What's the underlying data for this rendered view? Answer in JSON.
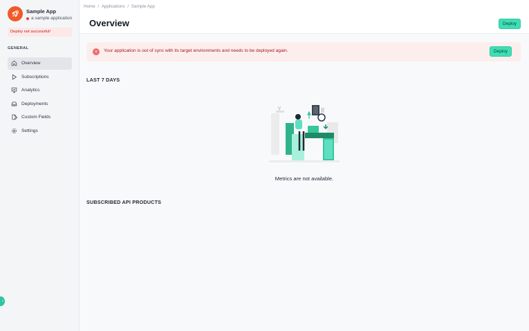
{
  "sidebar": {
    "app_name": "Sample App",
    "app_description": "a sample application",
    "status_color": "#e0413a",
    "avatar_color": "#f05a28",
    "deploy_status": "Deploy not successful!",
    "section_label": "GENERAL",
    "items": [
      {
        "label": "Overview",
        "icon": "home-icon",
        "active": true
      },
      {
        "label": "Subscriptions",
        "icon": "play-icon",
        "active": false
      },
      {
        "label": "Analytics",
        "icon": "presentation-chart-icon",
        "active": false
      },
      {
        "label": "Deployments",
        "icon": "inbox-tray-icon",
        "active": false
      },
      {
        "label": "Custom Fields",
        "icon": "document-edit-icon",
        "active": false
      },
      {
        "label": "Settings",
        "icon": "gear-icon",
        "active": false
      }
    ]
  },
  "breadcrumb": [
    "Home",
    "/",
    "Applications",
    "/",
    "Sample App"
  ],
  "header": {
    "title": "Overview",
    "deploy_label": "Deploy"
  },
  "banner": {
    "message": "Your application is out of sync with its target environments and needs to be deployed again.",
    "deploy_label": "Deploy",
    "icon": "close-circle-icon"
  },
  "main": {
    "metrics_heading": "LAST 7 DAYS",
    "metrics_empty": "Metrics are not available.",
    "products_heading": "SUBSCRIBED API PRODUCTS"
  },
  "colors": {
    "accent": "#3ddfb4",
    "error_bg": "#fdeeee",
    "error_text": "#a11b1b"
  }
}
